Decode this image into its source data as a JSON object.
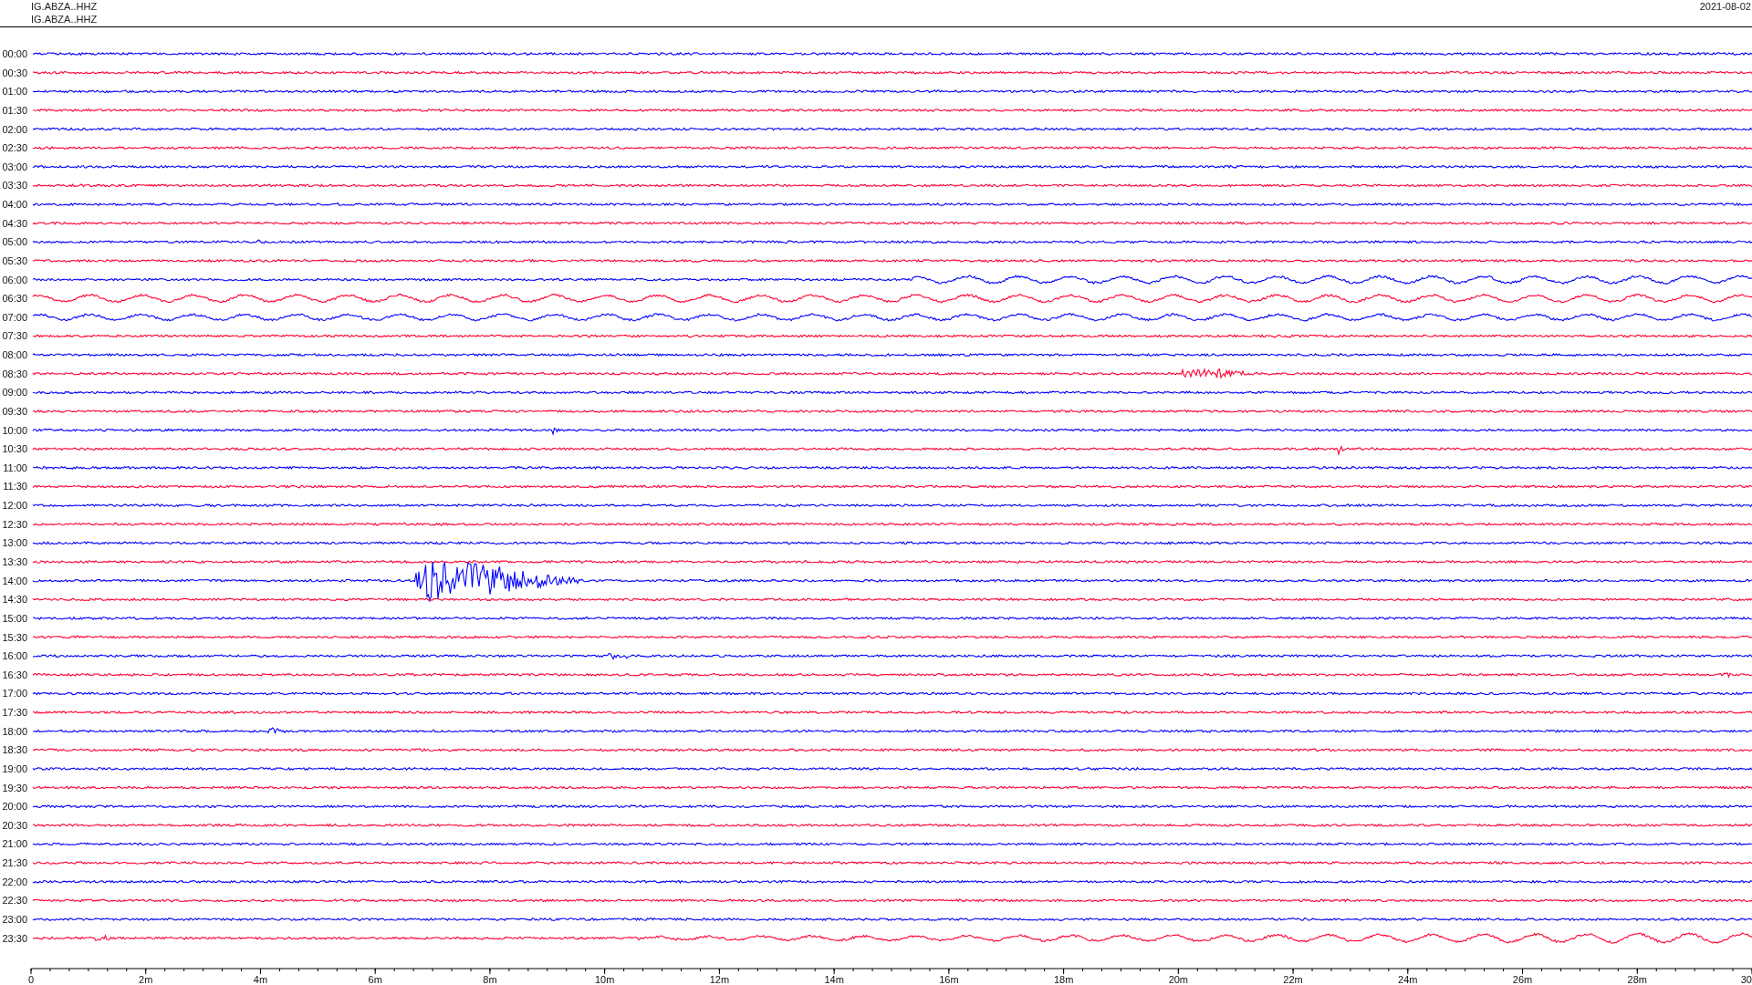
{
  "header": {
    "station_lines": [
      "IG.ABZA..HHZ",
      "IG.ABZA..HHZ"
    ],
    "date": "2021-08-02"
  },
  "rows": [
    {
      "label": "00:00",
      "color": "#0000ff"
    },
    {
      "label": "00:30",
      "color": "#ff0033"
    },
    {
      "label": "01:00",
      "color": "#0000ff"
    },
    {
      "label": "01:30",
      "color": "#ff0033"
    },
    {
      "label": "02:00",
      "color": "#0000ff"
    },
    {
      "label": "02:30",
      "color": "#ff0033"
    },
    {
      "label": "03:00",
      "color": "#0000ff"
    },
    {
      "label": "03:30",
      "color": "#ff0033"
    },
    {
      "label": "04:00",
      "color": "#0000ff"
    },
    {
      "label": "04:30",
      "color": "#ff0033"
    },
    {
      "label": "05:00",
      "color": "#0000ff"
    },
    {
      "label": "05:30",
      "color": "#ff0033"
    },
    {
      "label": "06:00",
      "color": "#0000ff"
    },
    {
      "label": "06:30",
      "color": "#ff0033"
    },
    {
      "label": "07:00",
      "color": "#0000ff"
    },
    {
      "label": "07:30",
      "color": "#ff0033"
    },
    {
      "label": "08:00",
      "color": "#0000ff"
    },
    {
      "label": "08:30",
      "color": "#ff0033"
    },
    {
      "label": "09:00",
      "color": "#0000ff"
    },
    {
      "label": "09:30",
      "color": "#ff0033"
    },
    {
      "label": "10:00",
      "color": "#0000ff"
    },
    {
      "label": "10:30",
      "color": "#ff0033"
    },
    {
      "label": "11:00",
      "color": "#0000ff"
    },
    {
      "label": "11:30",
      "color": "#ff0033"
    },
    {
      "label": "12:00",
      "color": "#0000ff"
    },
    {
      "label": "12:30",
      "color": "#ff0033"
    },
    {
      "label": "13:00",
      "color": "#0000ff"
    },
    {
      "label": "13:30",
      "color": "#ff0033"
    },
    {
      "label": "14:00",
      "color": "#0000ff"
    },
    {
      "label": "14:30",
      "color": "#ff0033"
    },
    {
      "label": "15:00",
      "color": "#0000ff"
    },
    {
      "label": "15:30",
      "color": "#ff0033"
    },
    {
      "label": "16:00",
      "color": "#0000ff"
    },
    {
      "label": "16:30",
      "color": "#ff0033"
    },
    {
      "label": "17:00",
      "color": "#0000ff"
    },
    {
      "label": "17:30",
      "color": "#ff0033"
    },
    {
      "label": "18:00",
      "color": "#0000ff"
    },
    {
      "label": "18:30",
      "color": "#ff0033"
    },
    {
      "label": "19:00",
      "color": "#0000ff"
    },
    {
      "label": "19:30",
      "color": "#ff0033"
    },
    {
      "label": "20:00",
      "color": "#0000ff"
    },
    {
      "label": "20:30",
      "color": "#ff0033"
    },
    {
      "label": "21:00",
      "color": "#0000ff"
    },
    {
      "label": "21:30",
      "color": "#ff0033"
    },
    {
      "label": "22:00",
      "color": "#0000ff"
    },
    {
      "label": "22:30",
      "color": "#ff0033"
    },
    {
      "label": "23:00",
      "color": "#0000ff"
    },
    {
      "label": "23:30",
      "color": "#ff0033"
    }
  ],
  "x_axis": {
    "tick_labels": [
      "0",
      "2m",
      "4m",
      "6m",
      "8m",
      "10m",
      "12m",
      "14m",
      "16m",
      "18m",
      "20m",
      "22m",
      "24m",
      "26m",
      "28m",
      "30"
    ]
  }
}
